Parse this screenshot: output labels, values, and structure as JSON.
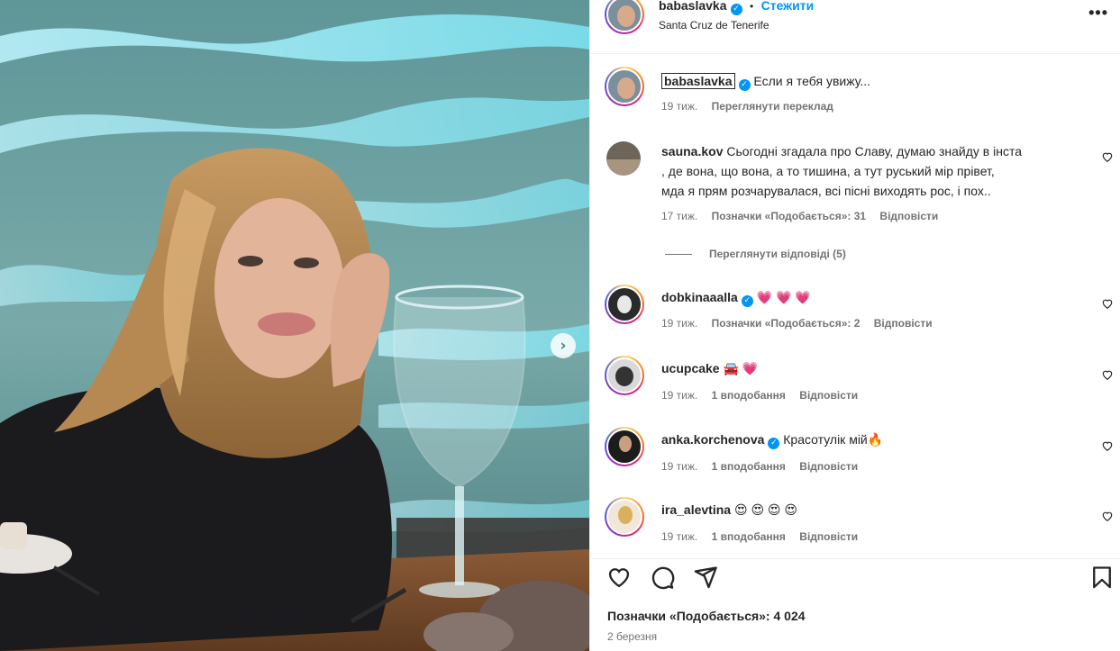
{
  "post": {
    "author": "babaslavka",
    "follow_label": "Стежити",
    "separator": "•",
    "location": "Santa Cruz de Tenerife",
    "more_label": "•••"
  },
  "caption": {
    "username": "babaslavka",
    "text": "Если я тебя увижу...",
    "time": "19 тиж.",
    "translate_label": "Переглянути переклад"
  },
  "comments": [
    {
      "username": "sauna.kov",
      "verified": false,
      "text_line1": "Сьогодні згадала про Славу, думаю знайду в інста",
      "text_line2": ", де вона, що вона, а то тишина, а тут руський мір прівет,",
      "text_line3": "мда я прям розчарувалася, всі пісні виходять рос, і пох..",
      "time": "17 тиж.",
      "likes": "Позначки «Подобається»: 31",
      "reply": "Відповісти",
      "view_replies": "Переглянути відповіді (5)"
    },
    {
      "username": "dobkinaaalla",
      "verified": true,
      "text": "💗 💗 💗",
      "time": "19 тиж.",
      "likes": "Позначки «Подобається»: 2",
      "reply": "Відповісти"
    },
    {
      "username": "ucupcake",
      "verified": false,
      "text": "🚘 💗",
      "time": "19 тиж.",
      "likes": "1 вподобання",
      "reply": "Відповісти"
    },
    {
      "username": "anka.korchenova",
      "verified": true,
      "text": "Красотулік мій🔥",
      "time": "19 тиж.",
      "likes": "1 вподобання",
      "reply": "Відповісти"
    },
    {
      "username": "ira_alevtina",
      "verified": false,
      "text": "😍 😍 😍 😍",
      "time": "19 тиж.",
      "likes": "1 вподобання",
      "reply": "Відповісти"
    }
  ],
  "footer": {
    "likes_label": "Позначки «Подобається»: 4 024",
    "date": "2 березня"
  },
  "icons": {
    "like": "heart-icon",
    "comment": "comment-icon",
    "share": "share-icon",
    "save": "bookmark-icon",
    "next": "chevron-right-icon",
    "verified": "verified-badge-icon"
  },
  "colors": {
    "accent": "#0095f6",
    "text": "#262626",
    "muted": "#737373",
    "divider": "#efefef"
  }
}
